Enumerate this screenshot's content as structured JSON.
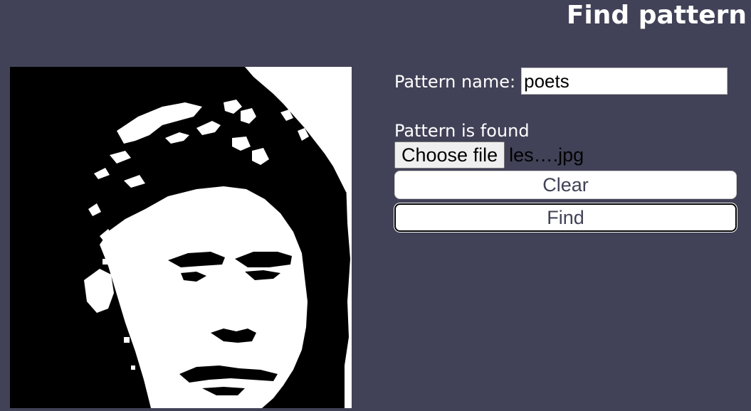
{
  "page": {
    "title": "Find pattern"
  },
  "form": {
    "name_label": "Pattern name:",
    "name_value": "poets",
    "status_text": "Pattern is found",
    "file_button_label": "Choose file",
    "file_name": "les….jpg",
    "clear_label": "Clear",
    "find_label": "Find"
  },
  "colors": {
    "background": "#414257",
    "accent_text": "#414257",
    "canvas_black": "#000000",
    "canvas_white": "#ffffff"
  },
  "canvas": {
    "description_icon": "binary-portrait-image"
  }
}
